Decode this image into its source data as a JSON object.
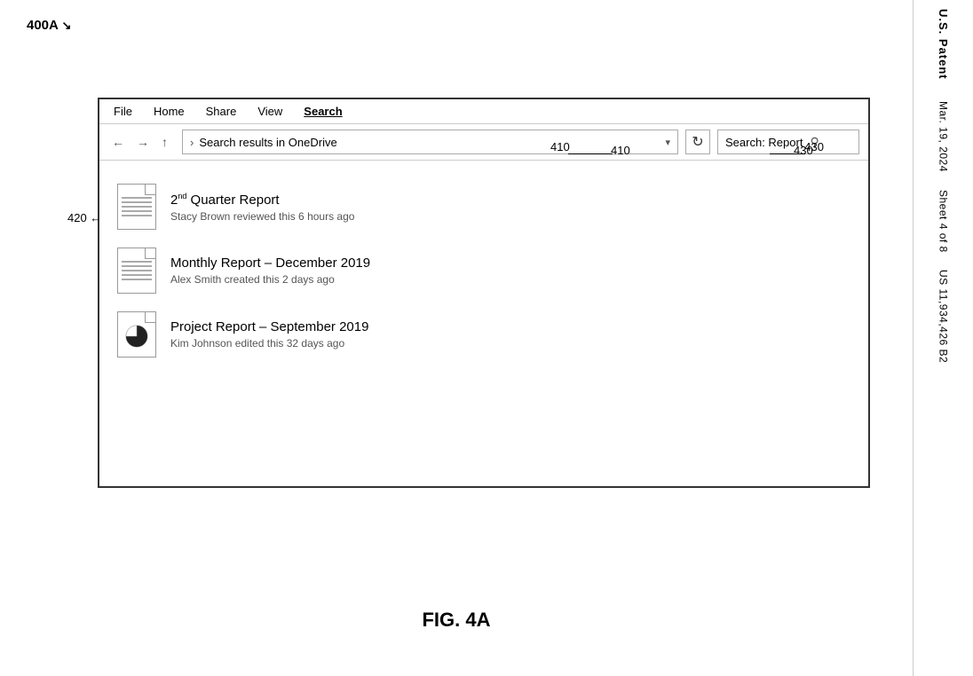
{
  "figure_label": "400A",
  "figure_caption": "FIG. 4A",
  "callout_410": "410",
  "callout_420": "420",
  "callout_430": "430",
  "menu": {
    "items": [
      {
        "label": "File",
        "active": false
      },
      {
        "label": "Home",
        "active": false
      },
      {
        "label": "Share",
        "active": false
      },
      {
        "label": "View",
        "active": false
      },
      {
        "label": "Search",
        "active": true
      }
    ]
  },
  "address_bar": {
    "chevron": ">",
    "text": "Search results in OneDrive",
    "dropdown_icon": "▾",
    "refresh_icon": "↻"
  },
  "search_field": {
    "label": "Search: Report",
    "icon": "🔍"
  },
  "files": [
    {
      "name_prefix": "2",
      "name_sup": "nd",
      "name_suffix": " Quarter Report",
      "meta": "Stacy Brown reviewed this 6 hours ago",
      "icon_type": "document"
    },
    {
      "name_prefix": "Monthly Report",
      "name_dash": " – ",
      "name_suffix": "December 2019",
      "meta": "Alex Smith created this 2 days ago",
      "icon_type": "document"
    },
    {
      "name_prefix": "Project Report",
      "name_dash": " – ",
      "name_suffix": "September 2019",
      "meta": "Kim Johnson edited this 32 days ago",
      "icon_type": "chart"
    }
  ],
  "patent_info": {
    "us_patent": "U.S. Patent",
    "date": "Mar. 19, 2024",
    "sheet": "Sheet 4 of 8",
    "number": "US 11,934,426 B2"
  }
}
